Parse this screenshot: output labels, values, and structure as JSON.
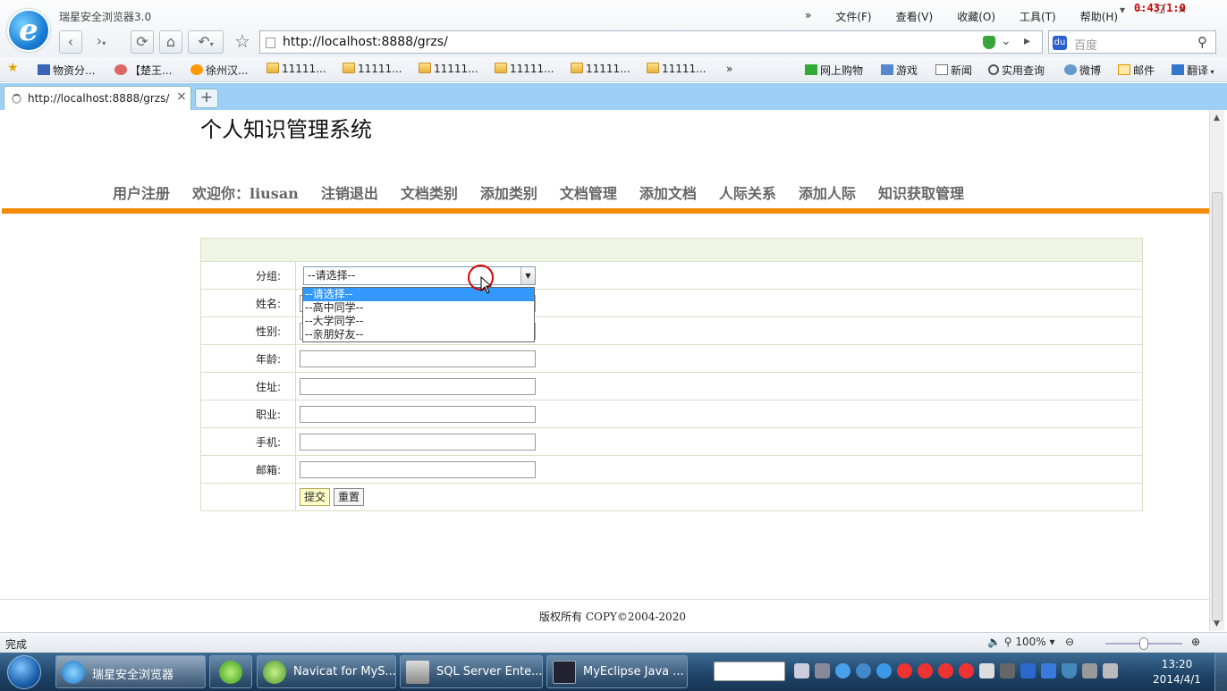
{
  "browser": {
    "app_title": "瑞星安全浏览器3.0",
    "menus": [
      "»",
      "文件(F)",
      "查看(V)",
      "收藏(O)",
      "工具(T)",
      "帮助(H)"
    ],
    "timer": "0:43/1:0",
    "nav": {
      "back": "‹",
      "forward": "›",
      "refresh": "⟳",
      "home": "⌂",
      "undo": "↶",
      "star": "☆"
    },
    "url": "http://localhost:8888/grzs/",
    "search_placeholder": "百度",
    "favorites": [
      {
        "label": "物资分...",
        "icon": "page-icon"
      },
      {
        "label": "【楚王...",
        "icon": "face-icon"
      },
      {
        "label": "徐州汉...",
        "icon": "face-icon"
      },
      {
        "label": "11111...",
        "icon": "folder-icon"
      },
      {
        "label": "11111...",
        "icon": "folder-icon"
      },
      {
        "label": "11111...",
        "icon": "folder-icon"
      },
      {
        "label": "11111...",
        "icon": "folder-icon"
      },
      {
        "label": "11111...",
        "icon": "folder-icon"
      },
      {
        "label": "11111...",
        "icon": "folder-icon"
      },
      {
        "label": "»",
        "icon": ""
      }
    ],
    "favorites_right": [
      "网上购物",
      "游戏",
      "新闻",
      "实用查询",
      "微博",
      "邮件",
      "翻译"
    ],
    "tab": {
      "title": "http://localhost:8888/grzs/",
      "close": "×",
      "new": "+"
    },
    "status": "完成",
    "zoom": "100%"
  },
  "page": {
    "site_title": "个人知识管理系统",
    "nav_items": [
      "用户注册",
      "欢迎你：liusan",
      "注销退出",
      "文档类别",
      "添加类别",
      "文档管理",
      "添加文档",
      "人际关系",
      "添加人际",
      "知识获取管理"
    ],
    "form": {
      "group_label": "分组:",
      "group_selected": "--请选择--",
      "group_options": [
        "--请选择--",
        "--高中同学--",
        "--大学同学--",
        "--亲朋好友--"
      ],
      "name_label": "姓名:",
      "gender_label": "性别:",
      "age_label": "年龄:",
      "address_label": "住址:",
      "job_label": "职业:",
      "phone_label": "手机:",
      "email_label": "邮箱:",
      "submit": "提交",
      "reset": "重置"
    },
    "copyright": "版权所有 COPY©2004-2020"
  },
  "taskbar": {
    "tasks": [
      "瑞星安全浏览器",
      "",
      "Navicat for MyS...",
      "SQL Server Ente...",
      "MyEclipse Java ..."
    ],
    "time": "13:20",
    "date": "2014/4/1"
  },
  "colors": {
    "accent_orange": "#f28c0a",
    "tab_bar": "#9ed0f7",
    "selection": "#3399ff"
  }
}
